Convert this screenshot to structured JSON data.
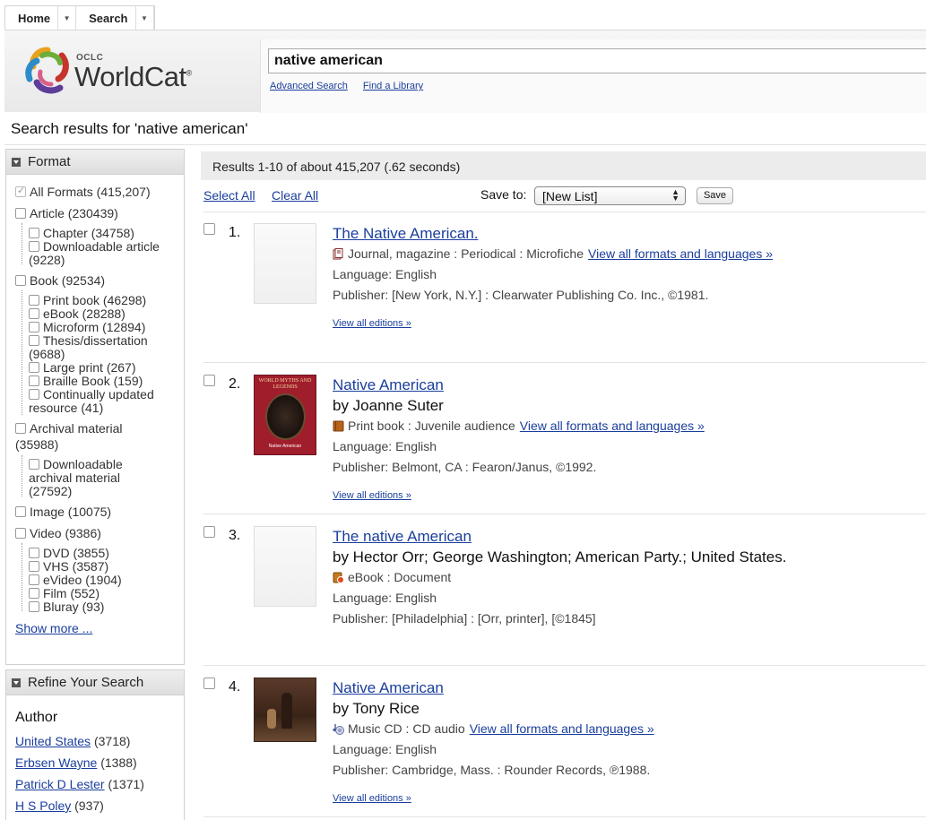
{
  "nav": {
    "home_label": "Home",
    "search_label": "Search"
  },
  "brand": {
    "oclc": "OCLC",
    "name": "WorldCat",
    "reg": "®"
  },
  "search": {
    "value": "native american",
    "advanced_label": "Advanced Search",
    "find_library_label": "Find a Library"
  },
  "heading": "Search results for 'native american'",
  "format_facet": {
    "header": "Format",
    "items": [
      "All Formats (415,207)",
      "Article (230439)",
      "Chapter (34758)",
      "Downloadable article",
      "(9228)",
      "Book (92534)",
      "Print book (46298)",
      "eBook (28288)",
      "Microform (12894)",
      "Thesis/dissertation",
      "(9688)",
      "Large print (267)",
      "Braille Book (159)",
      "Continually updated",
      "resource (41)",
      "Archival material",
      "(35988)",
      "Downloadable",
      "archival material",
      "(27592)",
      "Image (10075)",
      "Video (9386)",
      "DVD (3855)",
      "VHS (3587)",
      "eVideo (1904)",
      "Film (552)",
      "Bluray (93)"
    ],
    "show_more": "Show more ..."
  },
  "refine": {
    "header": "Refine Your Search",
    "author_label": "Author",
    "authors": [
      {
        "name": "United States",
        "count": "(3718)"
      },
      {
        "name": "Erbsen Wayne",
        "count": "(1388)"
      },
      {
        "name": "Patrick D Lester",
        "count": "(1371)"
      },
      {
        "name": "H S Poley",
        "count": "(937)"
      }
    ]
  },
  "results": {
    "summary": "Results 1-10 of about 415,207 (.62 seconds)",
    "select_all": "Select All",
    "clear_all": "Clear All",
    "save_to_label": "Save to:",
    "save_to_value": "[New List]",
    "save_button": "Save",
    "view_all_formats": "View all formats and languages »",
    "view_all_editions": "View all editions »",
    "records": [
      {
        "num": "1.",
        "title": "The Native American.",
        "author": "",
        "format": "Journal, magazine : Periodical : Microfiche",
        "format_icon": "journal-icon",
        "language": "Language: English",
        "publisher": "Publisher: [New York, N.Y.] : Clearwater Publishing Co. Inc., ©1981.",
        "thumb": "blank",
        "editions": true
      },
      {
        "num": "2.",
        "title": "Native American",
        "author": "by Joanne Suter",
        "format": "Print book : Juvenile audience",
        "format_icon": "book-icon",
        "language": "Language: English",
        "publisher": "Publisher: Belmont, CA : Fearon/Janus, ©1992.",
        "thumb": "cover-red",
        "cover_top_text": "WORLD MYTHS AND LEGENDS",
        "cover_bottom_text": "Native American",
        "editions": true
      },
      {
        "num": "3.",
        "title": "The native American",
        "author": "by Hector Orr; George Washington; American Party.; United States.",
        "format": "eBook : Document",
        "format_icon": "ebook-icon",
        "language": "Language: English",
        "publisher": "Publisher: [Philadelphia] : [Orr, printer], [©1845]",
        "thumb": "blank",
        "editions": false
      },
      {
        "num": "4.",
        "title": "Native American",
        "author": "by Tony Rice",
        "format": "Music CD : CD audio",
        "format_icon": "music-cd-icon",
        "language": "Language: English",
        "publisher": "Publisher: Cambridge, Mass. : Rounder Records, ℗1988.",
        "thumb": "cover-photo",
        "editions": true
      }
    ]
  },
  "colors": {
    "link": "#1a3e9c",
    "bar": "#ececec"
  }
}
